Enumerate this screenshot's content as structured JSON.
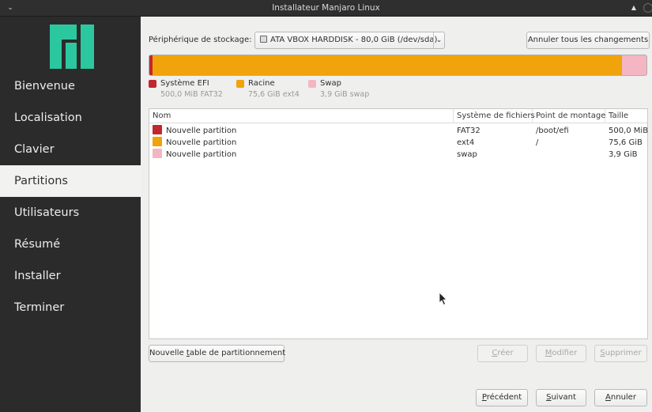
{
  "window": {
    "title": "Installateur Manjaro Linux",
    "menu_glyph": "⌄",
    "max_glyph": "▲"
  },
  "sidebar": {
    "items": [
      {
        "label": "Bienvenue"
      },
      {
        "label": "Localisation"
      },
      {
        "label": "Clavier"
      },
      {
        "label": "Partitions",
        "active": true
      },
      {
        "label": "Utilisateurs"
      },
      {
        "label": "Résumé"
      },
      {
        "label": "Installer"
      },
      {
        "label": "Terminer"
      }
    ]
  },
  "storage": {
    "label": "Périphérique de stockage:",
    "selected_device": "ATA VBOX HARDDISK - 80,0 GiB (/dev/sda)",
    "revert_label": "Annuler tous les changements"
  },
  "usage_bar": {
    "segments": [
      {
        "name": "Système EFI",
        "fraction": 0.006,
        "color": "#c1272d"
      },
      {
        "name": "Racine",
        "fraction": 0.945,
        "color": "#f0a30a"
      },
      {
        "name": "Swap",
        "fraction": 0.049,
        "color": "#f4b6c2"
      }
    ]
  },
  "legend": [
    {
      "name": "Système EFI",
      "info": "500,0 MiB FAT32",
      "color": "#c1272d"
    },
    {
      "name": "Racine",
      "info": "75,6 GiB ext4",
      "color": "#f0a30a"
    },
    {
      "name": "Swap",
      "info": "3,9 GiB swap",
      "color": "#f4b6c2"
    }
  ],
  "table": {
    "headers": {
      "name": "Nom",
      "fs": "Système de fichiers",
      "mount": "Point de montage",
      "size": "Taille"
    },
    "rows": [
      {
        "name": "Nouvelle partition",
        "fs": "FAT32",
        "mount": "/boot/efi",
        "size": "500,0 MiB",
        "color": "#c1272d"
      },
      {
        "name": "Nouvelle partition",
        "fs": "ext4",
        "mount": "/",
        "size": "75,6 GiB",
        "color": "#f0a30a"
      },
      {
        "name": "Nouvelle partition",
        "fs": "swap",
        "mount": "",
        "size": "3,9 GiB",
        "color": "#f4b6c2"
      }
    ]
  },
  "actions": {
    "new_table_pre": "Nouvelle ",
    "new_table_key": "t",
    "new_table_post": "able de partitionnement",
    "create_key": "C",
    "create_rest": "réer",
    "modify_key": "M",
    "modify_rest": "odifier",
    "delete_key": "S",
    "delete_rest": "upprimer"
  },
  "footer": {
    "back_key": "P",
    "back_rest": "récédent",
    "next_key": "S",
    "next_rest": "uivant",
    "cancel_key": "A",
    "cancel_rest": "nnuler"
  }
}
